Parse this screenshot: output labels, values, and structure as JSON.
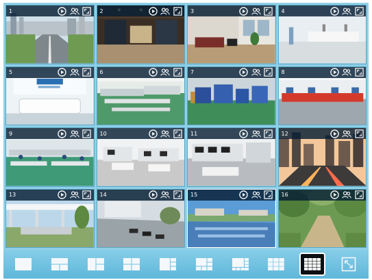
{
  "accent_color": "#5fb7da",
  "tile_icons": [
    "play-icon",
    "person-detect-icon",
    "fullscreen-icon"
  ],
  "channels": [
    {
      "number": "1",
      "scene": "road"
    },
    {
      "number": "2",
      "scene": "lobby"
    },
    {
      "number": "3",
      "scene": "lounge"
    },
    {
      "number": "4",
      "scene": "white-hall"
    },
    {
      "number": "5",
      "scene": "reception"
    },
    {
      "number": "6",
      "scene": "workshop"
    },
    {
      "number": "7",
      "scene": "warehouse"
    },
    {
      "number": "8",
      "scene": "production-line"
    },
    {
      "number": "9",
      "scene": "assembly"
    },
    {
      "number": "10",
      "scene": "office"
    },
    {
      "number": "11",
      "scene": "office-open"
    },
    {
      "number": "12",
      "scene": "city"
    },
    {
      "number": "13",
      "scene": "courtyard"
    },
    {
      "number": "14",
      "scene": "parking"
    },
    {
      "number": "15",
      "scene": "campus"
    },
    {
      "number": "16",
      "scene": "garden"
    }
  ],
  "selected_channel": "15",
  "layouts": [
    {
      "name": "layout-1-icon",
      "active": false
    },
    {
      "name": "layout-2-icon",
      "active": false
    },
    {
      "name": "layout-3-icon",
      "active": false
    },
    {
      "name": "layout-4-icon",
      "active": false
    },
    {
      "name": "layout-5-icon",
      "active": false
    },
    {
      "name": "layout-6-icon",
      "active": false
    },
    {
      "name": "layout-8-icon",
      "active": false
    },
    {
      "name": "layout-9-icon",
      "active": false
    },
    {
      "name": "layout-16-icon",
      "active": true
    },
    {
      "name": "fullscreen-icon",
      "active": false
    }
  ]
}
